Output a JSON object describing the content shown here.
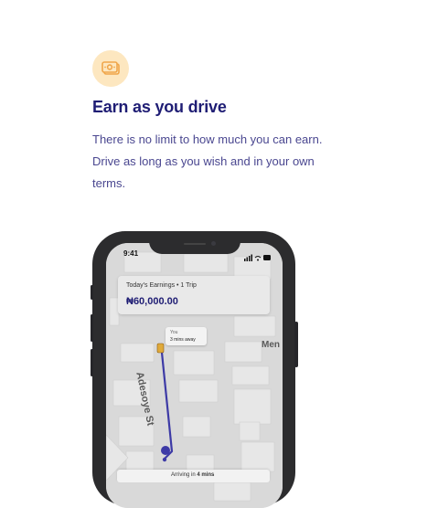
{
  "feature": {
    "icon": "money-stack-icon",
    "title": "Earn as you drive",
    "description": "There is no limit to how much you can earn. Drive as long as you wish and in your own terms."
  },
  "phone": {
    "status_time": "9:41",
    "earnings": {
      "label": "Today's Earnings • 1 Trip",
      "amount": "₦60,000.00"
    },
    "driver_bubble": {
      "label": "You",
      "eta": "3 mins away"
    },
    "street_name": "Adesoye St",
    "map_label": "Men",
    "arriving": {
      "prefix": "Arriving in ",
      "time": "4 mins"
    },
    "colors": {
      "route": "#3d3aa6",
      "accent": "#1f1d74",
      "icon_bg": "#fde7c0",
      "icon_fg": "#f0a64a"
    }
  }
}
